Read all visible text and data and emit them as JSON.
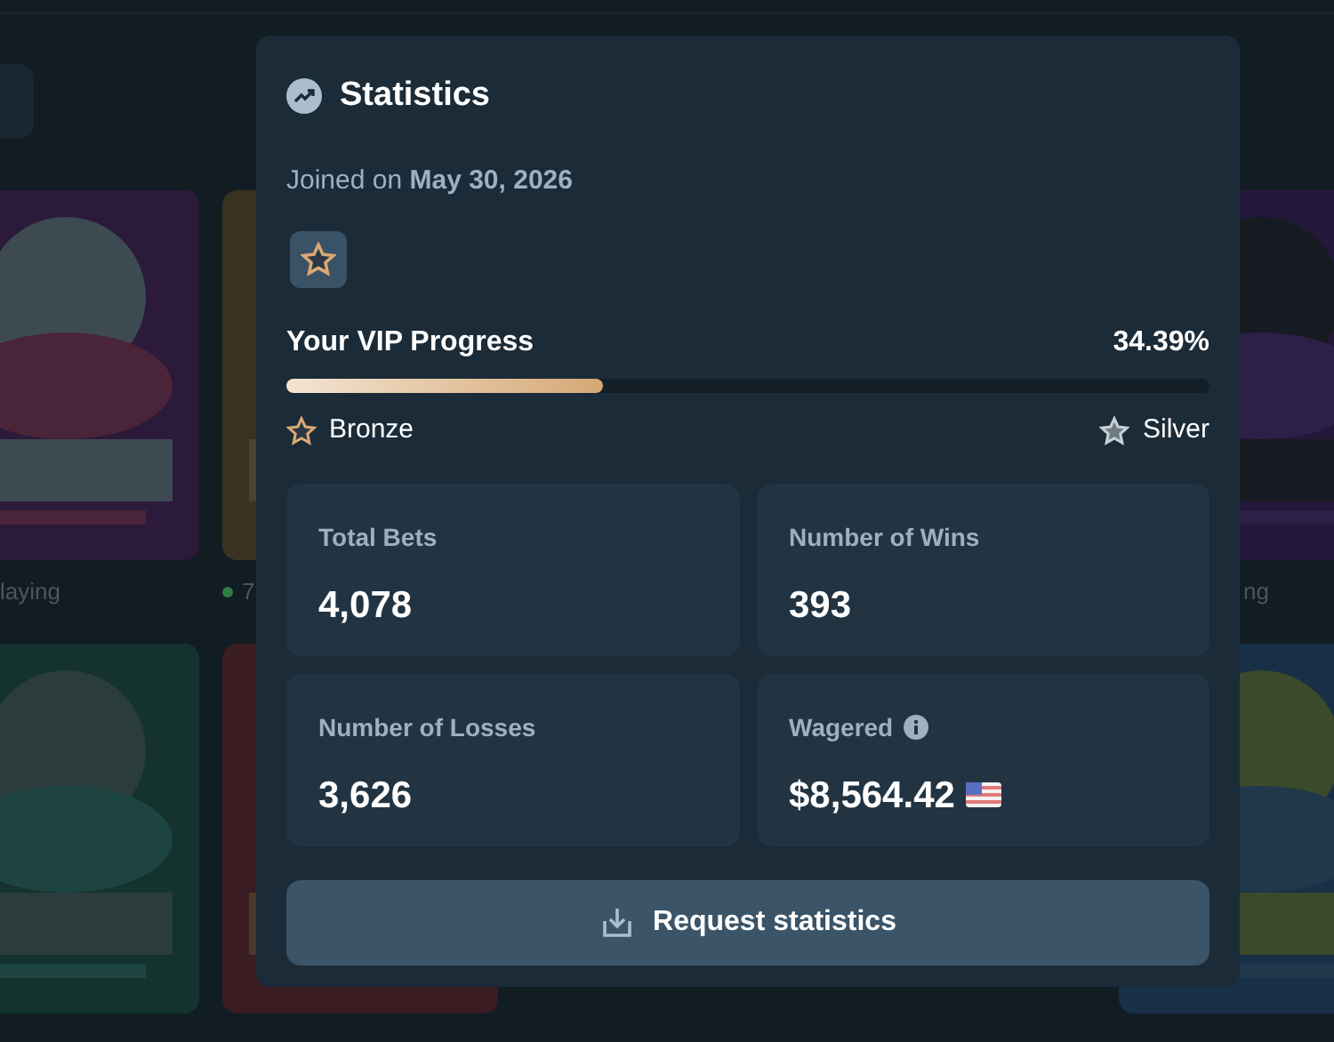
{
  "background": {
    "captions": [
      {
        "text": "laying",
        "live_dot": false
      },
      {
        "text": "7",
        "live_dot": true
      },
      {
        "text": "ng",
        "live_dot": false
      }
    ]
  },
  "modal": {
    "title": "Statistics",
    "joined": "Joined on **May 30, 2026**",
    "vip": {
      "label": "Your VIP Progress",
      "percent": "34.39%",
      "level": 0.3439,
      "current_tier": "Bronze",
      "next_tier": "Silver"
    },
    "stats": [
      {
        "label": "Total Bets",
        "value": "4,078",
        "info": false,
        "flag": false
      },
      {
        "label": "Number of Wins",
        "value": "393",
        "info": false,
        "flag": false
      },
      {
        "label": "Number of Losses",
        "value": "3,626",
        "info": false,
        "flag": false
      },
      {
        "label": "Wagered",
        "value": "$8,564.42",
        "info": true,
        "flag": true
      }
    ],
    "button": "Request statistics"
  }
}
